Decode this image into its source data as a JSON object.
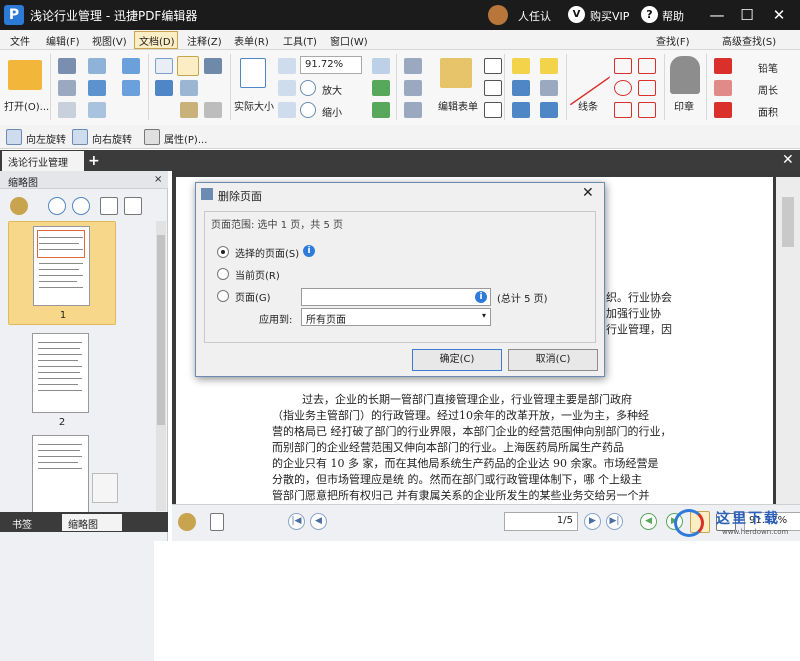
{
  "titlebar": {
    "title": "浅论行业管理 - 迅捷PDF编辑器",
    "logo": "P",
    "user": "人任认",
    "vip_icon": "V",
    "vip": "购买VIP",
    "help_icon": "?",
    "help": "帮助",
    "min": "—",
    "max": "☐",
    "close": "✕"
  },
  "menu": {
    "items": [
      "文件",
      "编辑(F)",
      "视图(V)",
      "文档(D)",
      "注释(Z)",
      "表单(R)",
      "工具(T)",
      "窗口(W)"
    ],
    "find": "查找(F)",
    "adv_find": "高级查找(S)"
  },
  "ribbon": {
    "open": "打开(O)...",
    "actual_size": "实际大小",
    "zoom_value": "91.72%",
    "zoom_in": "放大",
    "zoom_out": "缩小",
    "edit_form": "编辑表单",
    "lines": "线条",
    "stamp": "印章",
    "pencil": "铅笔",
    "perimeter": "周长",
    "area": "面积"
  },
  "quickbar": {
    "rotate_left": "向左旋转",
    "rotate_right": "向右旋转",
    "properties": "属性(P)..."
  },
  "tabs": {
    "doc": "浅论行业管理",
    "add": "+",
    "close_all": "✕"
  },
  "left_panel": {
    "title": "缩略图",
    "close": "×",
    "thumbs": [
      "1",
      "2"
    ],
    "bottom_tabs": [
      "书签",
      "缩略图"
    ]
  },
  "document": {
    "right_lines": [
      "织。行业协会",
      "加强行业协",
      "行业管理，因"
    ],
    "para": [
      "过去，企业的长期一管部门直接管理企业，行业管理主要是部门政府",
      "（指业务主管部门）的行政管理。经过10余年的改革开放，一业为主，多种经",
      "营的格局已 经打破了部门的行业界限，本部门企业的经营范围伸向别部门的行业，",
      "而别部门的企业经营范围又伸向本部门的行业。上海医药局所属生产药品",
      "的企业只有 10 多 家，而在其他局系统生产药品的企业达 90 余家。市场经营是",
      "分散的，但市场管理应是统   的。然而在部门或行政管理体制下，哪   个上级主",
      "管部门愿意把所有权归己 并有隶属关系的企业所发生的某些业务交给另一个并"
    ]
  },
  "statusbar": {
    "page": "1/5",
    "zoom": "91.72%"
  },
  "dialog": {
    "title": "删除页面",
    "close": "✕",
    "range": "页面范围: 选中 1 页，共 5 页",
    "opt_selected": "选择的页面(S)",
    "opt_current": "当前页(R)",
    "opt_pages": "页面(G)",
    "total": "(总计 5 页)",
    "apply_label": "应用到:",
    "apply_value": "所有页面",
    "info": "i",
    "ok": "确定(C)",
    "cancel": "取消(C)"
  },
  "watermark": {
    "text": "这里下载",
    "url": "www.herdown.com"
  },
  "colors": {
    "titlebar": "#1b1b1b",
    "accent_blue": "#2f7bd9",
    "selected_thumb": "#f7d88a",
    "dialog_border": "#6b8bb3"
  }
}
